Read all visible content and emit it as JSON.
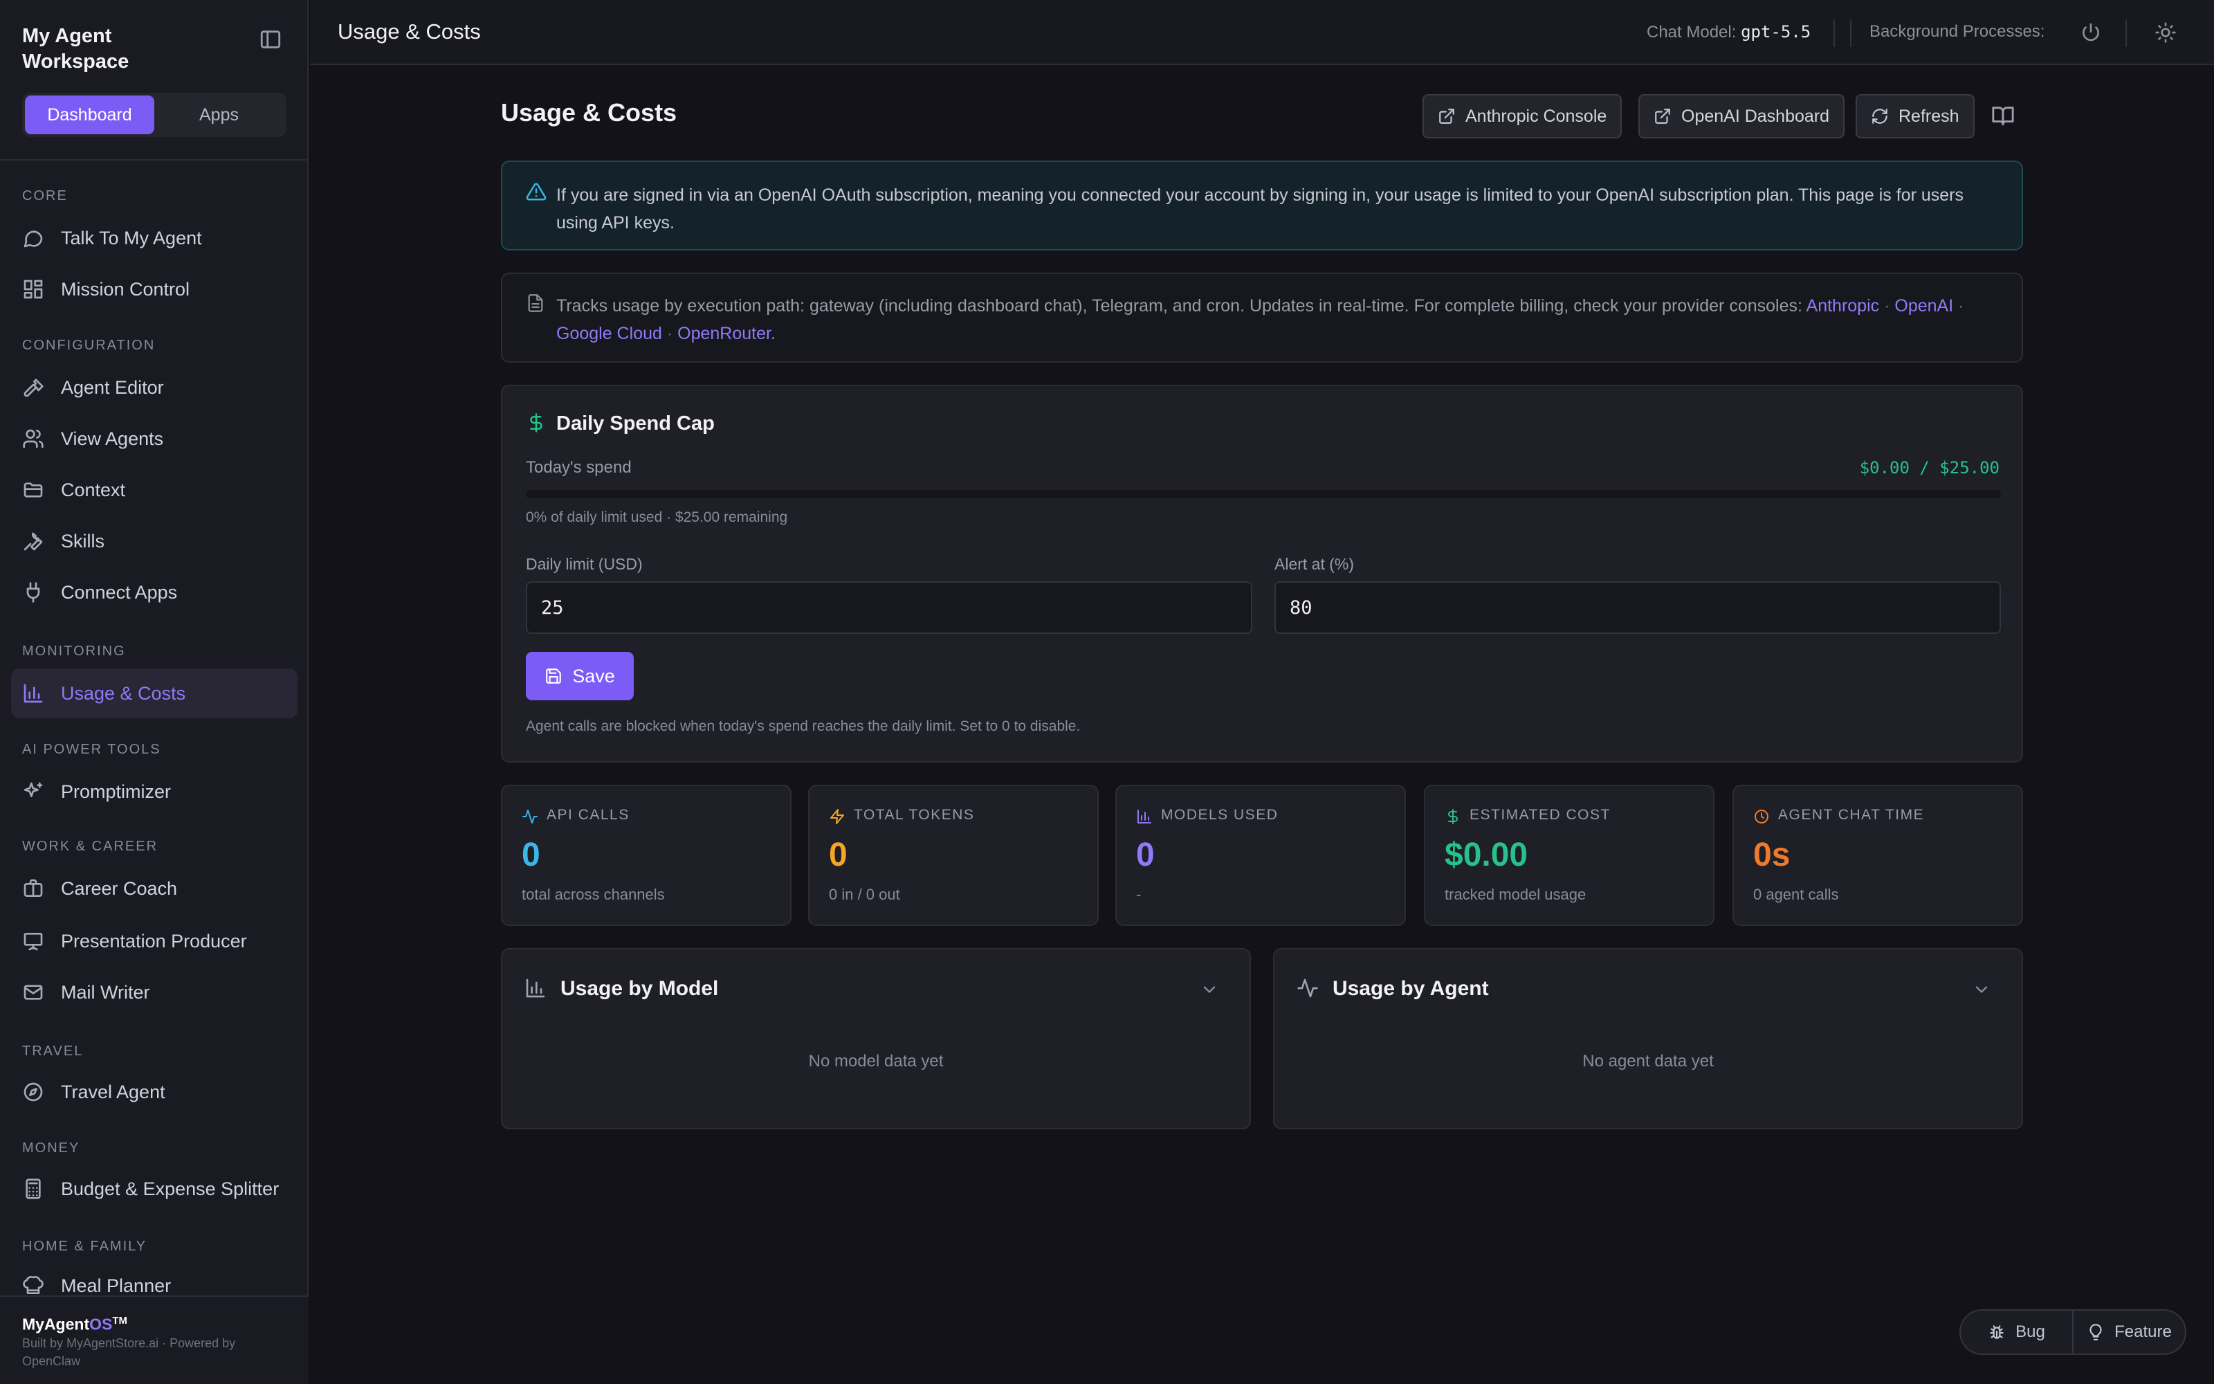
{
  "sidebar": {
    "workspace_title": "My Agent Workspace",
    "tabs": [
      "Dashboard",
      "Apps"
    ],
    "active_tab": "Dashboard",
    "sections": [
      {
        "label": "CORE",
        "items": [
          {
            "label": "Talk To My Agent",
            "icon": "chat-bubble-icon"
          },
          {
            "label": "Mission Control",
            "icon": "dashboard-grid-icon"
          }
        ]
      },
      {
        "label": "CONFIGURATION",
        "items": [
          {
            "label": "Agent Editor",
            "icon": "hammer-icon"
          },
          {
            "label": "View Agents",
            "icon": "users-icon"
          },
          {
            "label": "Context",
            "icon": "folder-icon"
          },
          {
            "label": "Skills",
            "icon": "wrench-icon"
          },
          {
            "label": "Connect Apps",
            "icon": "plug-icon"
          }
        ]
      },
      {
        "label": "MONITORING",
        "items": [
          {
            "label": "Usage & Costs",
            "icon": "bar-chart-icon",
            "active": true
          }
        ]
      },
      {
        "label": "AI POWER TOOLS",
        "items": [
          {
            "label": "Promptimizer",
            "icon": "sparkles-icon"
          }
        ]
      },
      {
        "label": "WORK & CAREER",
        "items": [
          {
            "label": "Career Coach",
            "icon": "briefcase-icon"
          },
          {
            "label": "Presentation Producer",
            "icon": "presentation-icon"
          },
          {
            "label": "Mail Writer",
            "icon": "mail-icon"
          }
        ]
      },
      {
        "label": "TRAVEL",
        "items": [
          {
            "label": "Travel Agent",
            "icon": "compass-icon"
          }
        ]
      },
      {
        "label": "MONEY",
        "items": [
          {
            "label": "Budget & Expense Splitter",
            "icon": "calculator-icon"
          }
        ]
      },
      {
        "label": "HOME & FAMILY",
        "items": [
          {
            "label": "Meal Planner",
            "icon": "chef-hat-icon"
          }
        ]
      }
    ],
    "footer": {
      "brand_prefix": "MyAgent",
      "brand_os": "OS",
      "brand_tm": "TM",
      "credits": "Built by MyAgentStore.ai · Powered by OpenClaw"
    }
  },
  "topbar": {
    "title": "Usage & Costs",
    "chat_model_label": "Chat Model:",
    "chat_model_value": "gpt-5.5",
    "background_label": "Background Processes:"
  },
  "page": {
    "title": "Usage & Costs",
    "buttons": {
      "anthropic": "Anthropic Console",
      "openai": "OpenAI Dashboard",
      "refresh": "Refresh"
    },
    "alert": "If you are signed in via an OpenAI OAuth subscription, meaning you connected your account by signing in, your usage is limited to your OpenAI subscription plan. This page is for users using API keys.",
    "info": {
      "text": "Tracks usage by execution path: gateway (including dashboard chat), Telegram, and cron. Updates in real-time. For complete billing, check your provider consoles:",
      "links": [
        "Anthropic",
        "OpenAI",
        "Google Cloud",
        "OpenRouter"
      ],
      "separator": "·",
      "end": "."
    }
  },
  "spend_cap": {
    "title": "Daily Spend Cap",
    "today_label": "Today's spend",
    "amount": "$0.00 / $25.00",
    "used_fraction": 0,
    "usage_note": "0% of daily limit used · $25.00 remaining",
    "limit_label": "Daily limit (USD)",
    "limit_value": "25",
    "alert_label": "Alert at (%)",
    "alert_value": "80",
    "save_label": "Save",
    "footnote": "Agent calls are blocked when today's spend reaches the daily limit. Set to 0 to disable."
  },
  "stats": [
    {
      "label": "API CALLS",
      "value": "0",
      "sub": "total across channels",
      "color": "#3ab7e8",
      "icon": "activity-icon"
    },
    {
      "label": "TOTAL TOKENS",
      "value": "0",
      "sub": "0 in / 0 out",
      "color": "#f5a623",
      "icon": "zap-icon"
    },
    {
      "label": "MODELS USED",
      "value": "0",
      "sub": "-",
      "color": "#8f7af7",
      "icon": "bar-chart-icon"
    },
    {
      "label": "ESTIMATED COST",
      "value": "$0.00",
      "sub": "tracked model usage",
      "color": "#26c28a",
      "icon": "dollar-icon"
    },
    {
      "label": "AGENT CHAT TIME",
      "value": "0s",
      "sub": "0 agent calls",
      "color": "#f07a2a",
      "icon": "clock-icon"
    }
  ],
  "panels": {
    "model": {
      "title": "Usage by Model",
      "empty": "No model data yet"
    },
    "agent": {
      "title": "Usage by Agent",
      "empty": "No agent data yet"
    }
  },
  "feedback": {
    "bug": "Bug",
    "feature": "Feature"
  }
}
